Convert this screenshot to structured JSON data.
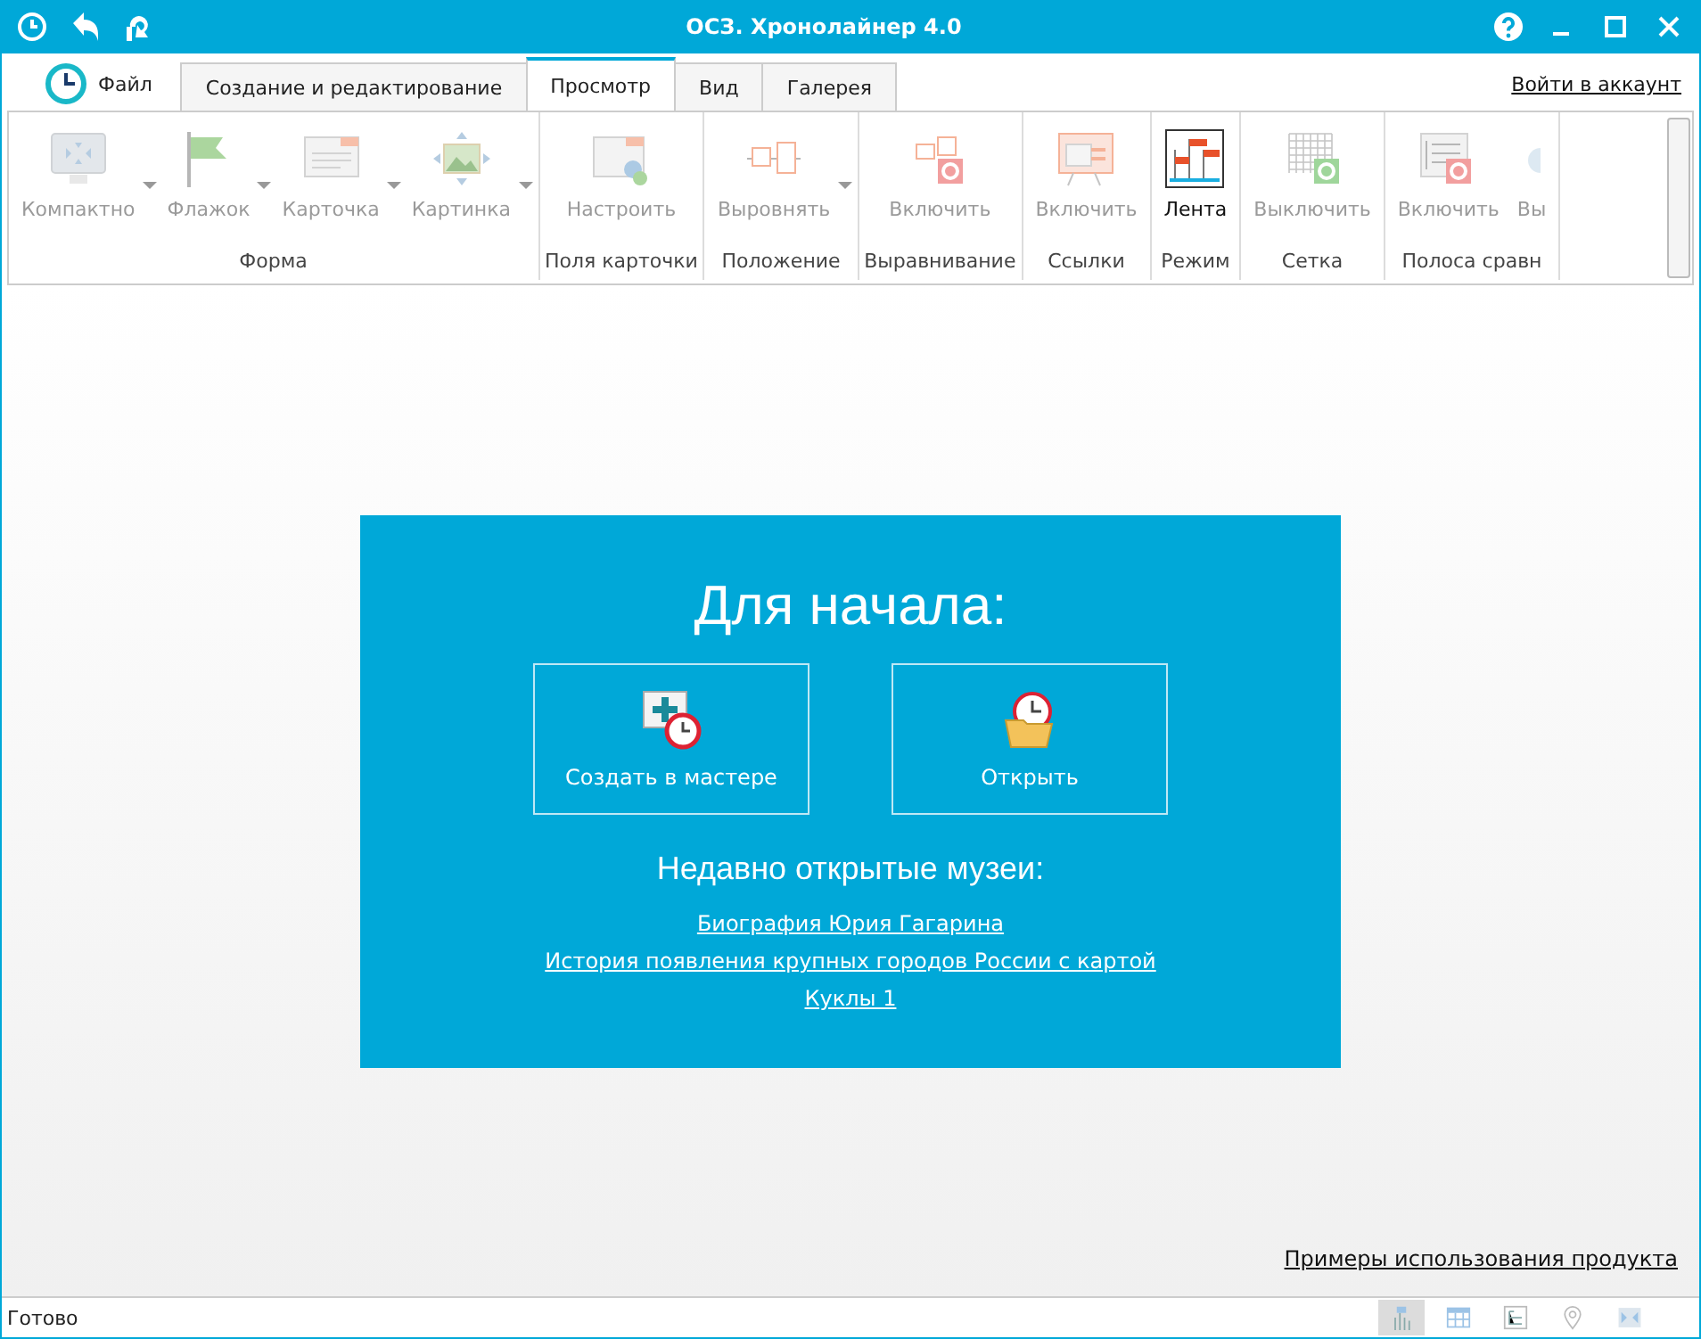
{
  "window": {
    "title": "ОСЗ. Хронолайнер 4.0"
  },
  "file_menu": {
    "label": "Файл"
  },
  "tabs": [
    {
      "label": "Создание и редактирование",
      "selected": false
    },
    {
      "label": "Просмотр",
      "selected": true
    },
    {
      "label": "Вид",
      "selected": false
    },
    {
      "label": "Галерея",
      "selected": false
    }
  ],
  "account_link": "Войти в аккаунт",
  "ribbon_groups": [
    {
      "label": "Форма",
      "buttons": [
        {
          "label": "Компактно",
          "disabled": true,
          "dropdown": true
        },
        {
          "label": "Флажок",
          "disabled": true,
          "dropdown": true
        },
        {
          "label": "Карточка",
          "disabled": true,
          "dropdown": true
        },
        {
          "label": "Картинка",
          "disabled": true,
          "dropdown": true
        }
      ]
    },
    {
      "label": "Поля карточки",
      "buttons": [
        {
          "label": "Настроить",
          "disabled": true,
          "dropdown": false
        }
      ]
    },
    {
      "label": "Положение",
      "buttons": [
        {
          "label": "Выровнять",
          "disabled": true,
          "dropdown": true
        }
      ]
    },
    {
      "label": "Выравнивание",
      "buttons": [
        {
          "label": "Включить",
          "disabled": true,
          "dropdown": false
        }
      ]
    },
    {
      "label": "Ссылки",
      "buttons": [
        {
          "label": "Включить",
          "disabled": true,
          "dropdown": false
        }
      ]
    },
    {
      "label": "Режим",
      "buttons": [
        {
          "label": "Лента",
          "disabled": false,
          "dropdown": false
        }
      ]
    },
    {
      "label": "Сетка",
      "buttons": [
        {
          "label": "Выключить",
          "disabled": true,
          "dropdown": false
        }
      ]
    },
    {
      "label": "Полоса сравн",
      "buttons": [
        {
          "label": "Включить",
          "disabled": true,
          "dropdown": false
        },
        {
          "label": "Вы",
          "disabled": true,
          "dropdown": false
        }
      ]
    }
  ],
  "start_panel": {
    "heading": "Для начала:",
    "actions": [
      {
        "label": "Создать в мастере"
      },
      {
        "label": "Открыть"
      }
    ],
    "recent_heading": "Недавно открытые музеи:",
    "recent": [
      "Биография Юрия Гагарина",
      "История появления крупных городов России с картой",
      "Куклы 1"
    ]
  },
  "examples_link": "Примеры использования продукта",
  "status_bar": {
    "text": "Готово",
    "view_buttons": [
      {
        "selected": true
      },
      {
        "selected": false
      },
      {
        "selected": false
      },
      {
        "selected": false
      },
      {
        "selected": false
      }
    ]
  }
}
